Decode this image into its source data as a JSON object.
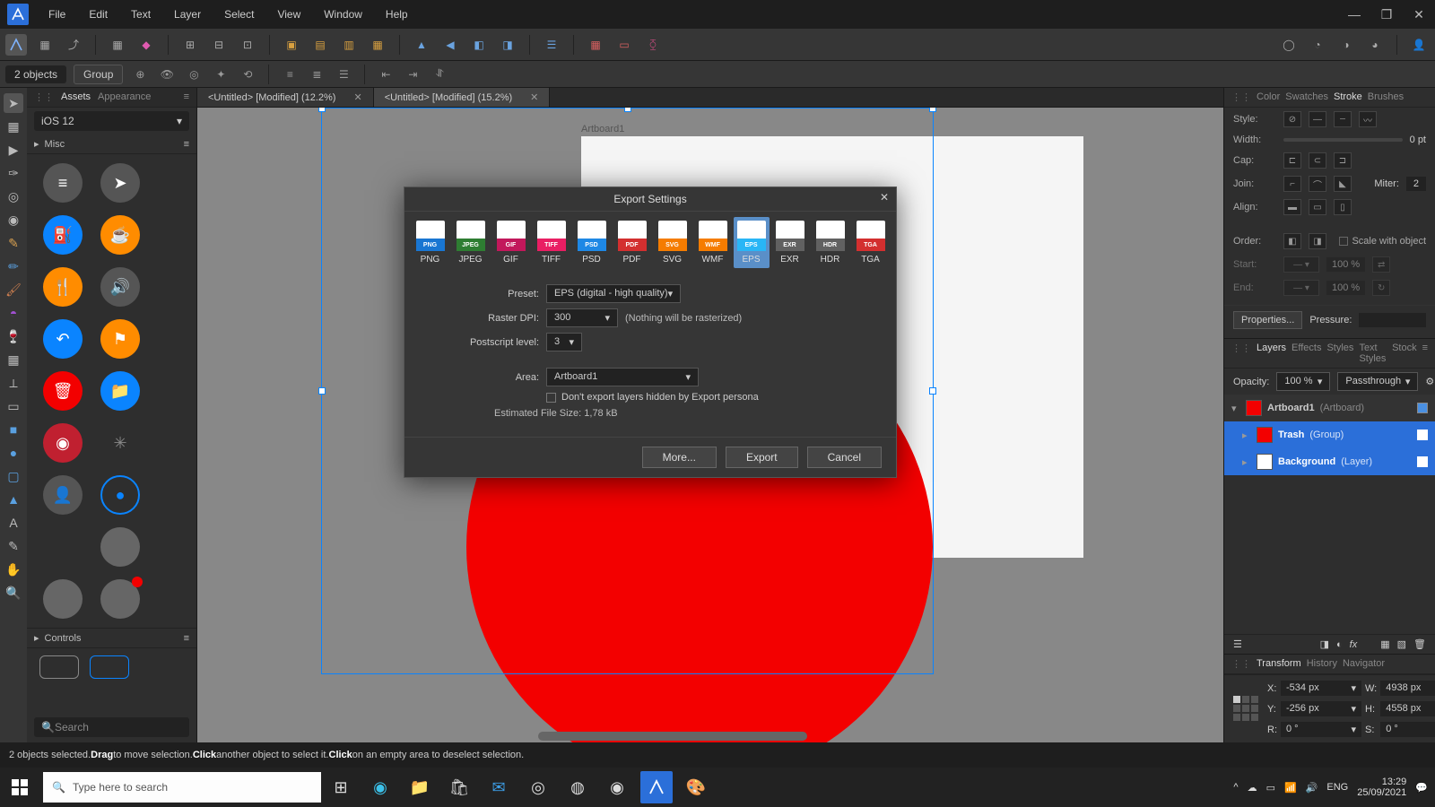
{
  "menu": {
    "items": [
      "File",
      "Edit",
      "Text",
      "Layer",
      "Select",
      "View",
      "Window",
      "Help"
    ]
  },
  "context": {
    "selection": "2 objects",
    "group_btn": "Group"
  },
  "left_panel": {
    "tabs": [
      "Assets",
      "Appearance"
    ],
    "preset_select": "iOS 12",
    "section1": "Misc",
    "section2": "Controls",
    "search_placeholder": "Search"
  },
  "doc_tabs": [
    {
      "title": "<Untitled> [Modified] (12.2%)"
    },
    {
      "title": "<Untitled> [Modified] (15.2%)"
    }
  ],
  "artboard_name": "Artboard1",
  "right": {
    "top_tabs": [
      "Color",
      "Swatches",
      "Stroke",
      "Brushes"
    ],
    "style_label": "Style:",
    "width_label": "Width:",
    "width_value": "0 pt",
    "cap_label": "Cap:",
    "join_label": "Join:",
    "miter_label": "Miter:",
    "miter_value": "2",
    "align_label": "Align:",
    "order_label": "Order:",
    "scale_label": "Scale with object",
    "start_label": "Start:",
    "end_label": "End:",
    "start_pct": "100 %",
    "end_pct": "100 %",
    "properties_btn": "Properties...",
    "pressure_label": "Pressure:",
    "layer_tabs": [
      "Layers",
      "Effects",
      "Styles",
      "Text Styles",
      "Stock"
    ],
    "opacity_label": "Opacity:",
    "opacity_value": "100 %",
    "blend": "Passthrough",
    "layers": [
      {
        "name": "Artboard1",
        "type": "(Artboard)"
      },
      {
        "name": "Trash",
        "type": "(Group)"
      },
      {
        "name": "Background",
        "type": "(Layer)"
      }
    ],
    "bottom_tabs": [
      "Transform",
      "History",
      "Navigator"
    ],
    "tf": {
      "x": "-534 px",
      "y": "-256 px",
      "w": "4938 px",
      "h": "4558 px",
      "r": "0 °",
      "s": "0 °",
      "xl": "X:",
      "yl": "Y:",
      "wl": "W:",
      "hl": "H:",
      "rl": "R:",
      "sl": "S:"
    }
  },
  "dialog": {
    "title": "Export Settings",
    "formats": [
      "PNG",
      "JPEG",
      "GIF",
      "TIFF",
      "PSD",
      "PDF",
      "SVG",
      "WMF",
      "EPS",
      "EXR",
      "HDR",
      "TGA"
    ],
    "format_colors": [
      "#1976d2",
      "#2e7d32",
      "#c2185b",
      "#e91e63",
      "#1e88e5",
      "#d32f2f",
      "#f57c00",
      "#f57c00",
      "#29b6f6",
      "#616161",
      "#616161",
      "#d32f2f"
    ],
    "selected_format": "EPS",
    "preset_label": "Preset:",
    "preset": "EPS (digital - high quality)",
    "dpi_label": "Raster DPI:",
    "dpi": "300",
    "dpi_note": "(Nothing will be rasterized)",
    "ps_label": "Postscript level:",
    "ps": "3",
    "area_label": "Area:",
    "area": "Artboard1",
    "checkbox": "Don't export layers hidden by Export persona",
    "size_label": "Estimated File Size:",
    "size": "1,78 kB",
    "more": "More...",
    "export": "Export",
    "cancel": "Cancel"
  },
  "status": {
    "parts": [
      "2 objects selected. ",
      "Drag",
      " to move selection. ",
      "Click",
      " another object to select it. ",
      "Click",
      " on an empty area to deselect selection."
    ]
  },
  "taskbar": {
    "search": "Type here to search",
    "time": "13:29",
    "date": "25/09/2021"
  }
}
